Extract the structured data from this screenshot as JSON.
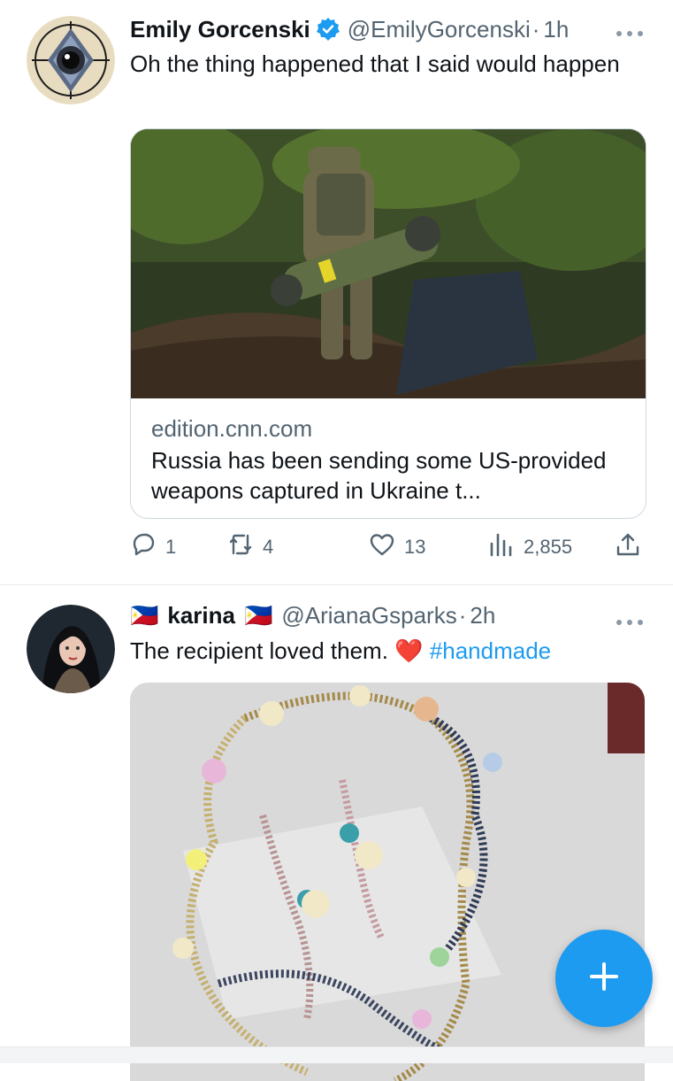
{
  "tweets": [
    {
      "name": "Emily Gorcenski",
      "handle": "@EmilyGorcenski",
      "separator": "·",
      "time": "1h",
      "text": "Oh the thing happened that I said would happen",
      "card": {
        "domain": "edition.cnn.com",
        "title": "Russia has been sending some US-provided weapons captured in Ukraine t..."
      },
      "actions": {
        "replies": "1",
        "retweets": "4",
        "likes": "13",
        "views": "2,855"
      }
    },
    {
      "flag_left": "🇵🇭",
      "name": "karina",
      "flag_right": "🇵🇭",
      "handle": "@ArianaGsparks",
      "separator": "·",
      "time": "2h",
      "text": "The recipient loved them.",
      "emoji": "❤️",
      "hashtag": "#handmade"
    }
  ],
  "colors": {
    "accent": "#1d9bf0",
    "secondary_text": "#536471",
    "border": "#cfd9de"
  },
  "icons": [
    "more-icon",
    "verified-badge-icon",
    "reply-icon",
    "retweet-icon",
    "like-icon",
    "views-icon",
    "share-icon",
    "compose-plus-icon"
  ]
}
